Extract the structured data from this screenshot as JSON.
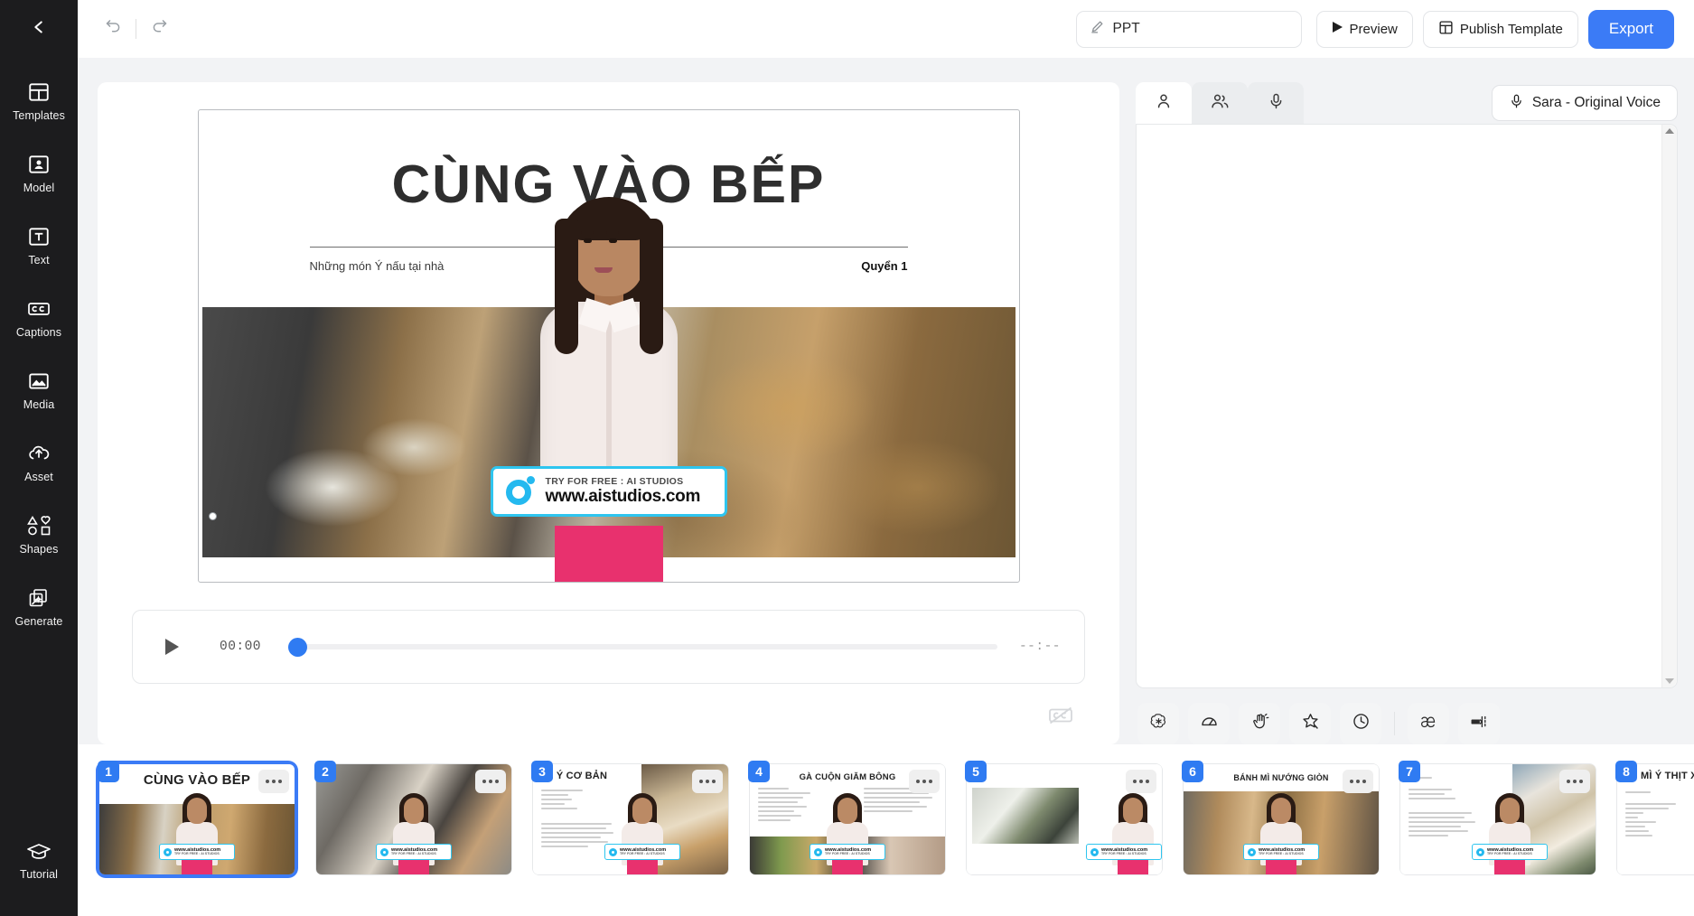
{
  "sidebar": {
    "back_icon": "chevron-left-icon",
    "items": [
      {
        "label": "Templates",
        "icon": "templates-icon"
      },
      {
        "label": "Model",
        "icon": "model-icon"
      },
      {
        "label": "Text",
        "icon": "text-icon"
      },
      {
        "label": "Captions",
        "icon": "captions-icon"
      },
      {
        "label": "Media",
        "icon": "media-icon"
      },
      {
        "label": "Asset",
        "icon": "asset-upload-icon"
      },
      {
        "label": "Shapes",
        "icon": "shapes-icon"
      },
      {
        "label": "Generate",
        "icon": "generate-magic-icon"
      }
    ],
    "bottom": {
      "label": "Tutorial",
      "icon": "graduation-cap-icon"
    }
  },
  "header": {
    "undo_icon": "undo-icon",
    "redo_icon": "redo-icon",
    "project_name": "PPT",
    "project_edit_icon": "pencil-icon",
    "preview_label": "Preview",
    "preview_icon": "play-icon",
    "publish_label": "Publish Template",
    "publish_icon": "template-grid-icon",
    "export_label": "Export",
    "accent_color": "#3b7bf6"
  },
  "slide": {
    "title": "CÙNG VÀO BẾP",
    "subtitle_left": "Những món Ý nấu tại nhà",
    "subtitle_right": "Quyển 1",
    "watermark": {
      "top_text": "TRY FOR FREE : AI STUDIOS",
      "main_text": "www.aistudios.com",
      "border_color": "#2ec5ef"
    }
  },
  "player": {
    "play_icon": "play-icon",
    "current_time": "00:00",
    "total_time": "--:--",
    "progress_percent": 0,
    "knob_color": "#2f7bf2"
  },
  "canvas_tools": {
    "captions_off_icon": "captions-off-icon"
  },
  "script_panel": {
    "tabs": [
      {
        "icon": "single-person-icon",
        "active": true
      },
      {
        "icon": "two-people-icon",
        "active": false
      },
      {
        "icon": "microphone-icon",
        "active": false
      }
    ],
    "voice_chip": {
      "icon": "microphone-icon",
      "label": "Sara - Original Voice"
    },
    "script_text": "",
    "script_placeholder": "",
    "scrollbar": {
      "up_icon": "caret-up-icon",
      "down_icon": "caret-down-icon"
    },
    "tools": [
      {
        "icon": "chatgpt-icon",
        "name": "ai-assist"
      },
      {
        "icon": "speed-gauge-icon",
        "name": "speed"
      },
      {
        "icon": "wave-hand-icon",
        "name": "gesture"
      },
      {
        "icon": "sparkle-star-icon",
        "name": "effects"
      },
      {
        "icon": "clock-icon",
        "name": "pause-timing"
      },
      {
        "icon": "divider",
        "name": "divider"
      },
      {
        "icon": "phonetic-ae-icon",
        "name": "pronunciation"
      },
      {
        "icon": "text-break-icon",
        "name": "line-break"
      }
    ]
  },
  "thumbnails": [
    {
      "number": "1",
      "title": "CÙNG VÀO BẾP",
      "selected": true,
      "layout": "title-hero"
    },
    {
      "number": "2",
      "title": "",
      "selected": false,
      "layout": "photo-full"
    },
    {
      "number": "3",
      "title": "MÌ Ý CƠ BẢN",
      "selected": false,
      "layout": "text-left"
    },
    {
      "number": "4",
      "title": "GÀ CUỘN GIĂM BÔNG",
      "selected": false,
      "layout": "text-split"
    },
    {
      "number": "5",
      "title": "",
      "selected": false,
      "layout": "photo-small"
    },
    {
      "number": "6",
      "title": "BÁNH MÌ NƯỚNG GIÒN",
      "selected": false,
      "layout": "photo-wide"
    },
    {
      "number": "7",
      "title": "",
      "selected": false,
      "layout": "text-left"
    },
    {
      "number": "8",
      "title": "MÌ Ý THỊT XÔ",
      "selected": false,
      "layout": "text-left"
    }
  ]
}
